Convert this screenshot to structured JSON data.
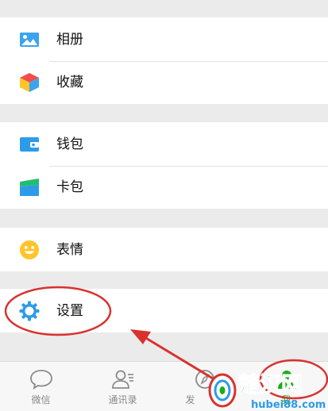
{
  "menu": {
    "album": {
      "label": "相册",
      "icon": "album-icon"
    },
    "favorites": {
      "label": "收藏",
      "icon": "favorites-cube-icon"
    },
    "wallet": {
      "label": "钱包",
      "icon": "wallet-icon"
    },
    "cards": {
      "label": "卡包",
      "icon": "card-package-icon"
    },
    "stickers": {
      "label": "表情",
      "icon": "smiley-icon"
    },
    "settings": {
      "label": "设置",
      "icon": "gear-icon"
    }
  },
  "tabbar": {
    "chats": {
      "label": "微信",
      "icon": "chat-bubble-icon"
    },
    "contacts": {
      "label": "通讯录",
      "icon": "contacts-icon"
    },
    "discover": {
      "label": "发",
      "icon": "compass-icon"
    },
    "me": {
      "label": "我",
      "icon": "person-icon"
    }
  },
  "watermark": {
    "text": "楚汉网",
    "url": "hubei88.com"
  },
  "colors": {
    "accent_blue": "#2d9be8",
    "annotation_red": "#d8322f",
    "me_green": "#1aad19"
  }
}
